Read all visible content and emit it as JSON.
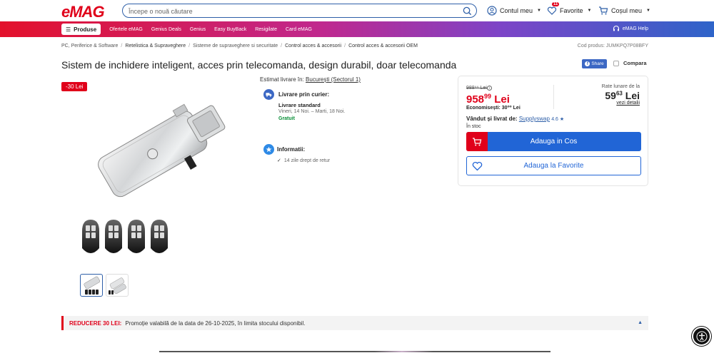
{
  "header": {
    "logo": "eMAG",
    "search_placeholder": "Începe o nouă căutare",
    "account_label": "Contul meu",
    "favorites_label": "Favorite",
    "favorites_count": "11",
    "cart_label": "Coșul meu"
  },
  "nav": {
    "products_label": "Produse",
    "links": [
      "Ofertele eMAG",
      "Genius Deals",
      "Genius",
      "Easy BuyBack",
      "Resigilate",
      "Card eMAG"
    ],
    "help_label": "eMAG Help"
  },
  "breadcrumb": {
    "items": [
      "PC, Periferice & Software",
      "Retelistica & Supraveghere",
      "Sisteme de supraveghere si securitate",
      "Control acces & accesorii",
      "Control acces & accesorii OEM"
    ]
  },
  "product": {
    "code": "Cod produs: JUMKPQ7P08BFY",
    "title": "Sistem de inchidere inteligent, acces prin telecomanda, design durabil, doar telecomanda",
    "share_label": "Share",
    "compare_label": "Compara",
    "discount_tag": "-30 Lei"
  },
  "delivery": {
    "estimate_label": "Estimat livrare în:",
    "location": "București (Sectorul 1)",
    "courier_title": "Livrare prin curier:",
    "standard_label": "Livrare standard",
    "dates": "Vineri, 14 Noi. – Marti, 18 Noi.",
    "free_label": "Gratuit",
    "info_title": "Informatii:",
    "return_label": "14 zile drept de retur"
  },
  "price": {
    "old_price": "988⁹⁹ Lei",
    "new_price_main": "958",
    "new_price_dec": "99",
    "currency": "Lei",
    "savings": "Economisești: 30⁰⁰ Lei",
    "installments_label": "Rate lunare de la",
    "installment_main": "59",
    "installment_dec": "63",
    "installment_currency": "Lei",
    "details_label": "vezi detalii",
    "seller_prefix": "Vândut și livrat de:",
    "seller_name": "Supplyswap",
    "seller_rating": "4.6 ★",
    "stock": "În stoc",
    "add_to_cart": "Adauga in Cos",
    "add_to_fav": "Adauga la Favorite"
  },
  "promo": {
    "label": "REDUCERE 30 LEI:",
    "text": "Promoție valabilă de la data de 26-10-2025, în limita stocului disponibil."
  },
  "colors": {
    "brand_red": "#e0001a",
    "brand_blue": "#2165d6",
    "success_green": "#0a8f38"
  }
}
